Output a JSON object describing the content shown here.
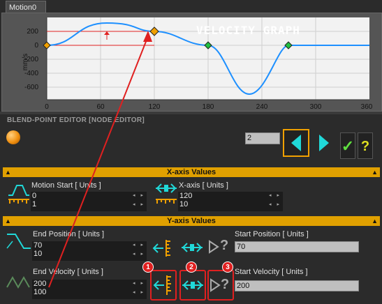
{
  "tab": {
    "label": "Motion0"
  },
  "graph": {
    "title": "VELOCITY GRAPH",
    "ylabel": "mm/s",
    "y_ticks": [
      "200",
      "0",
      "-200",
      "-400",
      "-600"
    ],
    "x_ticks": [
      "0",
      "60",
      "120",
      "180",
      "240",
      "300",
      "360"
    ],
    "line_color": "#1e90ff",
    "marker_colors": {
      "active": "#f0a000",
      "green": "#20c040",
      "segment": "#f07020"
    }
  },
  "editor": {
    "title": "BLEND-POINT EDITOR [NODE EDITOR]",
    "node_index": "2",
    "apply_label": "✓",
    "help_label": "?"
  },
  "x_section": {
    "title": "X-axis Values",
    "motion_start": {
      "label": "Motion Start [ Units ]",
      "value": "0",
      "step": "1"
    },
    "x_axis": {
      "label": "X-axis [ Units ]",
      "value": "120",
      "step": "10"
    }
  },
  "y_section": {
    "title": "Y-axis Values",
    "end_position": {
      "label": "End Position [ Units ]",
      "value": "70",
      "step": "10"
    },
    "start_position": {
      "label": "Start Position [ Units ]",
      "value": "70"
    },
    "end_velocity": {
      "label": "End Velocity [ Units ]",
      "value": "200",
      "step": "100"
    },
    "start_velocity": {
      "label": "Start Velocity [ Units ]",
      "value": "200"
    },
    "unknown_glyph": "?"
  },
  "annotations": {
    "badges": [
      "1",
      "2",
      "3"
    ],
    "color": "#e02020"
  },
  "accent_cyan": "#20d8d8",
  "accent_orange": "#f0a000"
}
